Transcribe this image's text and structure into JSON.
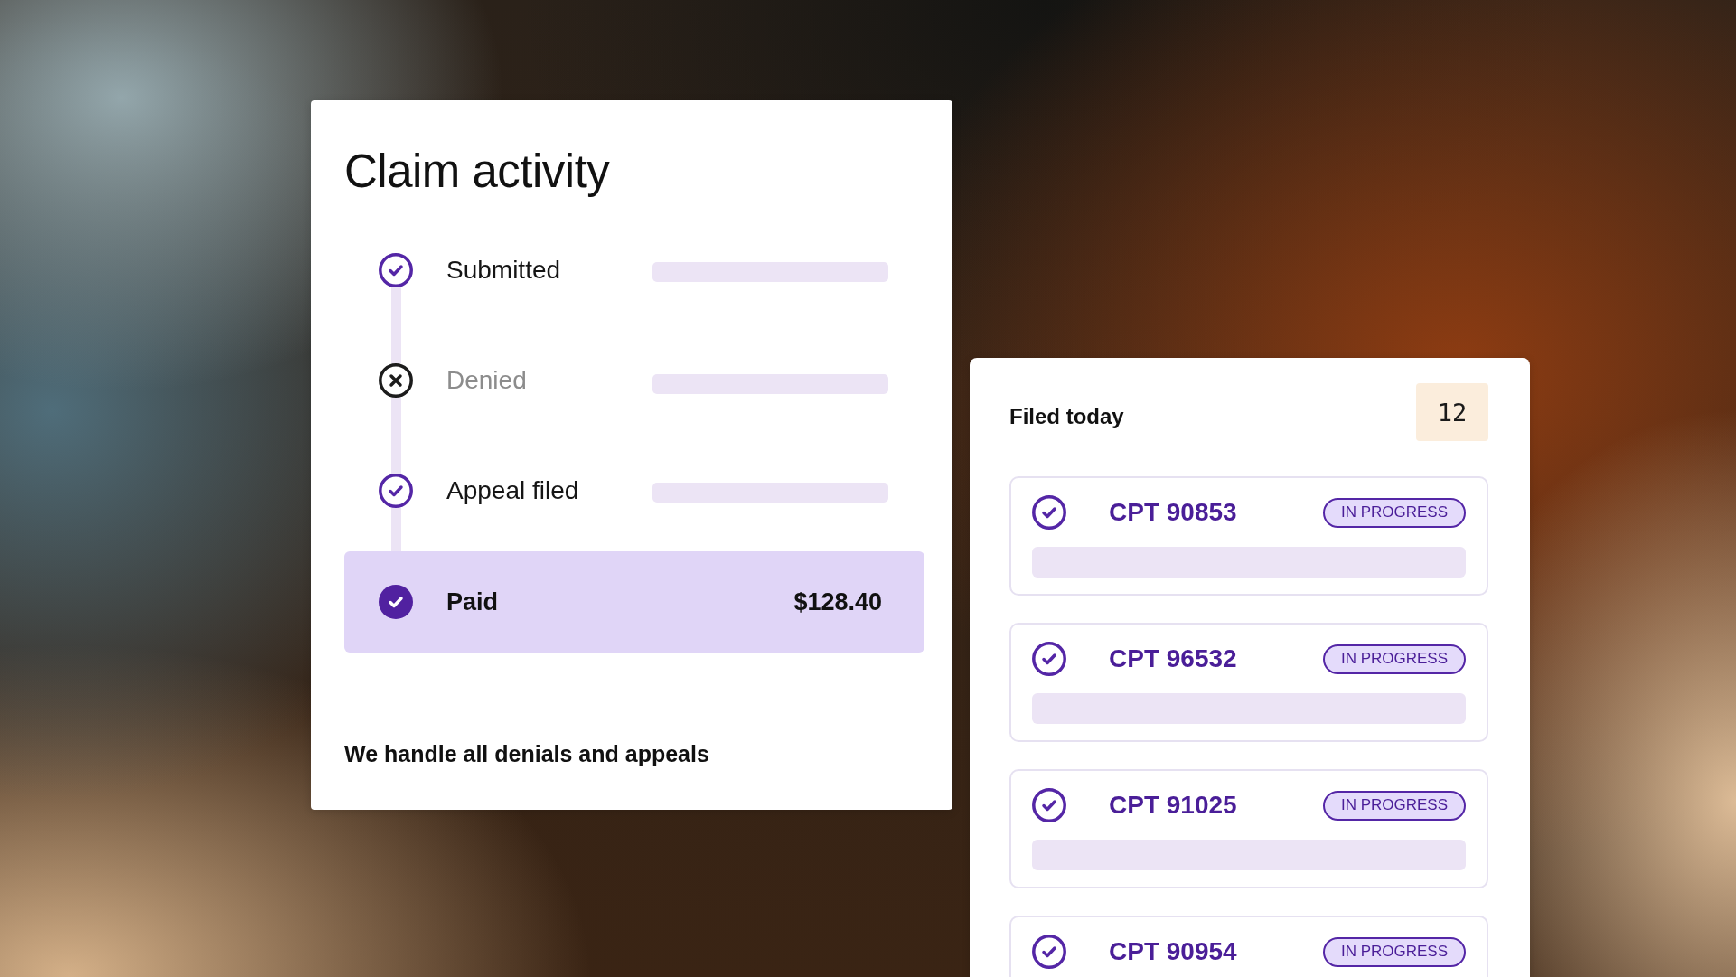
{
  "claim_activity": {
    "title": "Claim activity",
    "steps": [
      {
        "kind": "done",
        "label": "Submitted"
      },
      {
        "kind": "denied",
        "label": "Denied"
      },
      {
        "kind": "done",
        "label": "Appeal filed"
      },
      {
        "kind": "paid",
        "label": "Paid",
        "amount": "$128.40"
      }
    ],
    "footer": "We handle all denials and appeals"
  },
  "filed_today": {
    "title": "Filed today",
    "count": "12",
    "claims": [
      {
        "code": "CPT 90853",
        "status": "IN PROGRESS"
      },
      {
        "code": "CPT 96532",
        "status": "IN PROGRESS"
      },
      {
        "code": "CPT 91025",
        "status": "IN PROGRESS"
      },
      {
        "code": "CPT 90954",
        "status": "IN PROGRESS"
      }
    ]
  }
}
